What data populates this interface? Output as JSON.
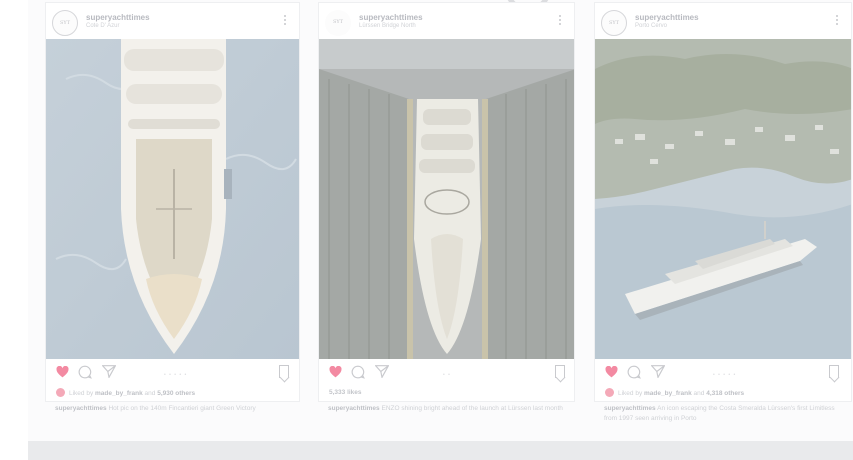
{
  "posts": [
    {
      "username": "superyachttimes",
      "location": "Cote D' Azur",
      "avatar_text": "SYT",
      "liked_by_user": "made_by_frank",
      "liked_by_others": "5,930 others",
      "likes": "",
      "caption_user": "superyachttimes",
      "caption_text": "Hot pic on the 140m Fincantieri giant Green Victory"
    },
    {
      "username": "superyachttimes",
      "location": "Lürssen Bridge North",
      "avatar_text": "SYT",
      "liked_by_user": "",
      "liked_by_others": "",
      "likes": "5,333 likes",
      "caption_user": "superyachttimes",
      "caption_text": "ENZO shining bright ahead of the launch at Lürssen last month"
    },
    {
      "username": "superyachttimes",
      "location": "Porto Cervo",
      "avatar_text": "SYT",
      "liked_by_user": "made_by_frank",
      "liked_by_others": "4,318 others",
      "likes": "",
      "caption_user": "superyachttimes",
      "caption_text": "An icon escaping the Costa Smeralda Lürssen's first Limitless from 1997 seen arriving in Porto"
    }
  ],
  "labels": {
    "liked_by": "Liked by",
    "and": "and"
  },
  "icons": {
    "like": "heart-icon",
    "comment": "comment-icon",
    "share": "paper-plane-icon",
    "save": "bookmark-icon",
    "more": "more-dots-icon"
  },
  "colors": {
    "like_active": "#f06a88",
    "text_muted": "#c3c5ca"
  }
}
